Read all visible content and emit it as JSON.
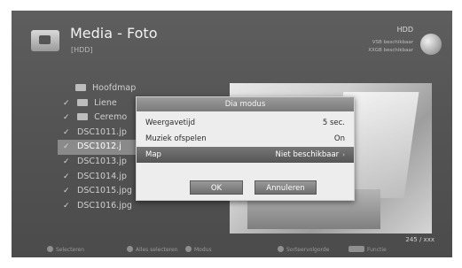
{
  "header": {
    "title": "Media - Foto",
    "subtitle": "[HDD]",
    "device": "HDD",
    "storage_line1": "VSB beschikbaar",
    "storage_line2": "XXGB beschikbaar"
  },
  "file_list": [
    {
      "label": "Hoofdmap",
      "checked": false,
      "folder": true
    },
    {
      "label": "Liene",
      "checked": true,
      "folder": true
    },
    {
      "label": "Ceremo",
      "checked": true,
      "folder": true
    },
    {
      "label": "DSC1011.jp",
      "checked": true,
      "folder": false
    },
    {
      "label": "DSC1012.j",
      "checked": true,
      "folder": false,
      "selected": true
    },
    {
      "label": "DSC1013.jp",
      "checked": true,
      "folder": false
    },
    {
      "label": "DSC1014.jp",
      "checked": true,
      "folder": false
    },
    {
      "label": "DSC1015.jpg",
      "checked": true,
      "folder": false
    },
    {
      "label": "DSC1016.jpg",
      "checked": true,
      "folder": false
    }
  ],
  "preview": {
    "counter": "245 / xxx"
  },
  "dialog": {
    "title": "Dia modus",
    "options": [
      {
        "label": "Weergavetijd",
        "value": "5 sec."
      },
      {
        "label": "Muziek ofspelen",
        "value": "On"
      },
      {
        "label": "Map",
        "value": "Niet beschikbaar",
        "highlighted": true
      }
    ],
    "ok_label": "OK",
    "cancel_label": "Annuleren"
  },
  "footer": {
    "items": [
      "Selecteren",
      "Alles selecteren",
      "Modus",
      "Sorteervolgorde",
      "Functie"
    ]
  }
}
